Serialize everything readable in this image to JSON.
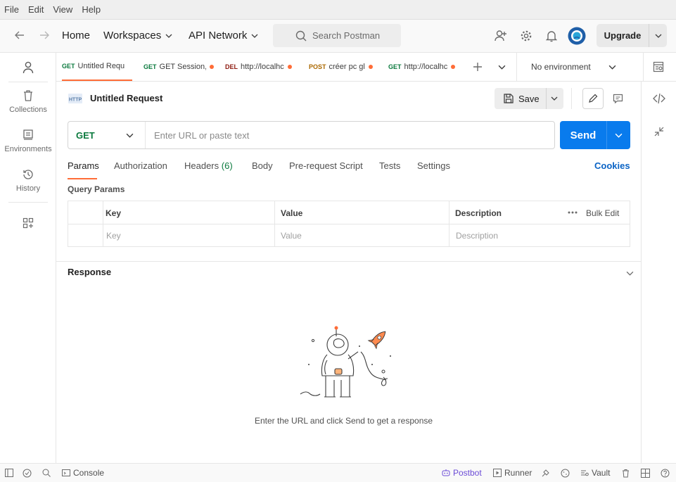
{
  "menubar": [
    "File",
    "Edit",
    "View",
    "Help"
  ],
  "header": {
    "home": "Home",
    "workspaces": "Workspaces",
    "api_network": "API Network",
    "search_placeholder": "Search Postman",
    "upgrade": "Upgrade"
  },
  "sidebar": {
    "items": [
      {
        "label": "Collections",
        "icon": "trash-can-icon"
      },
      {
        "label": "Environments",
        "icon": "environment-icon"
      },
      {
        "label": "History",
        "icon": "history-icon"
      }
    ]
  },
  "tabs": [
    {
      "method": "GET",
      "label": "Untitled Requ",
      "color": "#0b7a3e",
      "unsaved": false
    },
    {
      "method": "GET",
      "label": "GET Session,",
      "color": "#0b7a3e",
      "unsaved": true
    },
    {
      "method": "DEL",
      "label": "http://localhc",
      "color": "#8e1a10",
      "unsaved": true
    },
    {
      "method": "POST",
      "label": "créer pc gl",
      "color": "#ab6800",
      "unsaved": true
    },
    {
      "method": "GET",
      "label": "http://localhc",
      "color": "#0b7a3e",
      "unsaved": true
    }
  ],
  "environment": "No environment",
  "request": {
    "title": "Untitled Request",
    "save": "Save",
    "method": "GET",
    "url_placeholder": "Enter URL or paste text",
    "send": "Send",
    "tabs": [
      "Params",
      "Authorization",
      "Headers",
      "Body",
      "Pre-request Script",
      "Tests",
      "Settings"
    ],
    "headers_count": "(6)",
    "cookies": "Cookies",
    "query_params_label": "Query Params",
    "table": {
      "headers": [
        "Key",
        "Value",
        "Description"
      ],
      "bulk_edit": "Bulk Edit",
      "placeholders": [
        "Key",
        "Value",
        "Description"
      ]
    }
  },
  "response": {
    "title": "Response",
    "empty_message": "Enter the URL and click Send to get a response"
  },
  "statusbar": {
    "console": "Console",
    "postbot": "Postbot",
    "runner": "Runner",
    "vault": "Vault"
  },
  "colors": {
    "accent": "#ff6c37",
    "send_blue": "#097bed",
    "cookies_blue": "#0a63c5",
    "get_green": "#0b7a3e",
    "postbot_purple": "#6b4bd6"
  }
}
